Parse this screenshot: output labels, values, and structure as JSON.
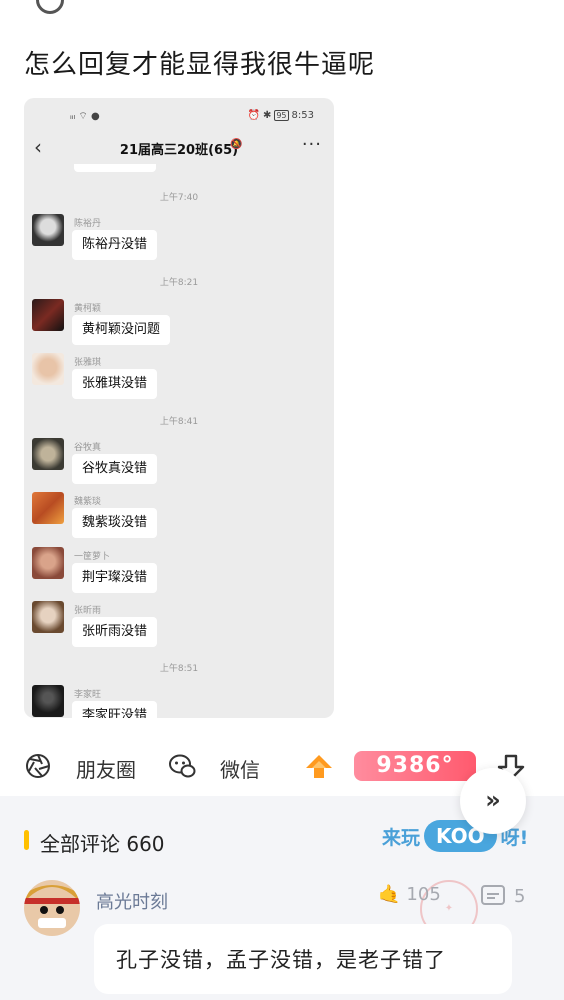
{
  "post": {
    "title": "怎么回复才能显得我很牛逼呢"
  },
  "screenshot": {
    "status": {
      "signal": "⁴⁶ᵢᵢₗ",
      "battery": "95",
      "time": "8:53"
    },
    "chat_title": "21届高三20班(65)",
    "timestamps": [
      "上午7:40",
      "上午8:21",
      "上午8:41",
      "上午8:51"
    ],
    "messages": [
      {
        "sender": "陈裕丹",
        "text": "陈裕丹没错"
      },
      {
        "sender": "黄柯颖",
        "text": "黄柯颖没问题"
      },
      {
        "sender": "张雅琪",
        "text": "张雅琪没错"
      },
      {
        "sender": "谷牧真",
        "text": "谷牧真没错"
      },
      {
        "sender": "魏紫琰",
        "text": "魏紫琰没错"
      },
      {
        "sender": "一筐萝卜",
        "text": "荆宇璨没错"
      },
      {
        "sender": "张昕雨",
        "text": "张昕雨没错"
      },
      {
        "sender": "李家旺",
        "text": "李家旺没错"
      }
    ]
  },
  "actions": {
    "moments_label": "朋友圈",
    "wechat_label": "微信",
    "score": "9386°"
  },
  "comments": {
    "header": "全部评论 660",
    "promo": {
      "prefix": "来玩",
      "badge": "KOO",
      "suffix": "呀!"
    },
    "items": [
      {
        "user": "高光时刻",
        "likes": "105",
        "replies": "5",
        "text": "孔子没错，孟子没错，是老子错了"
      }
    ]
  },
  "colors": {
    "accent_yellow": "#ffc000",
    "score_pink": "#ff5a6e",
    "promo_blue": "#49a6de",
    "username": "#6b7a96"
  }
}
